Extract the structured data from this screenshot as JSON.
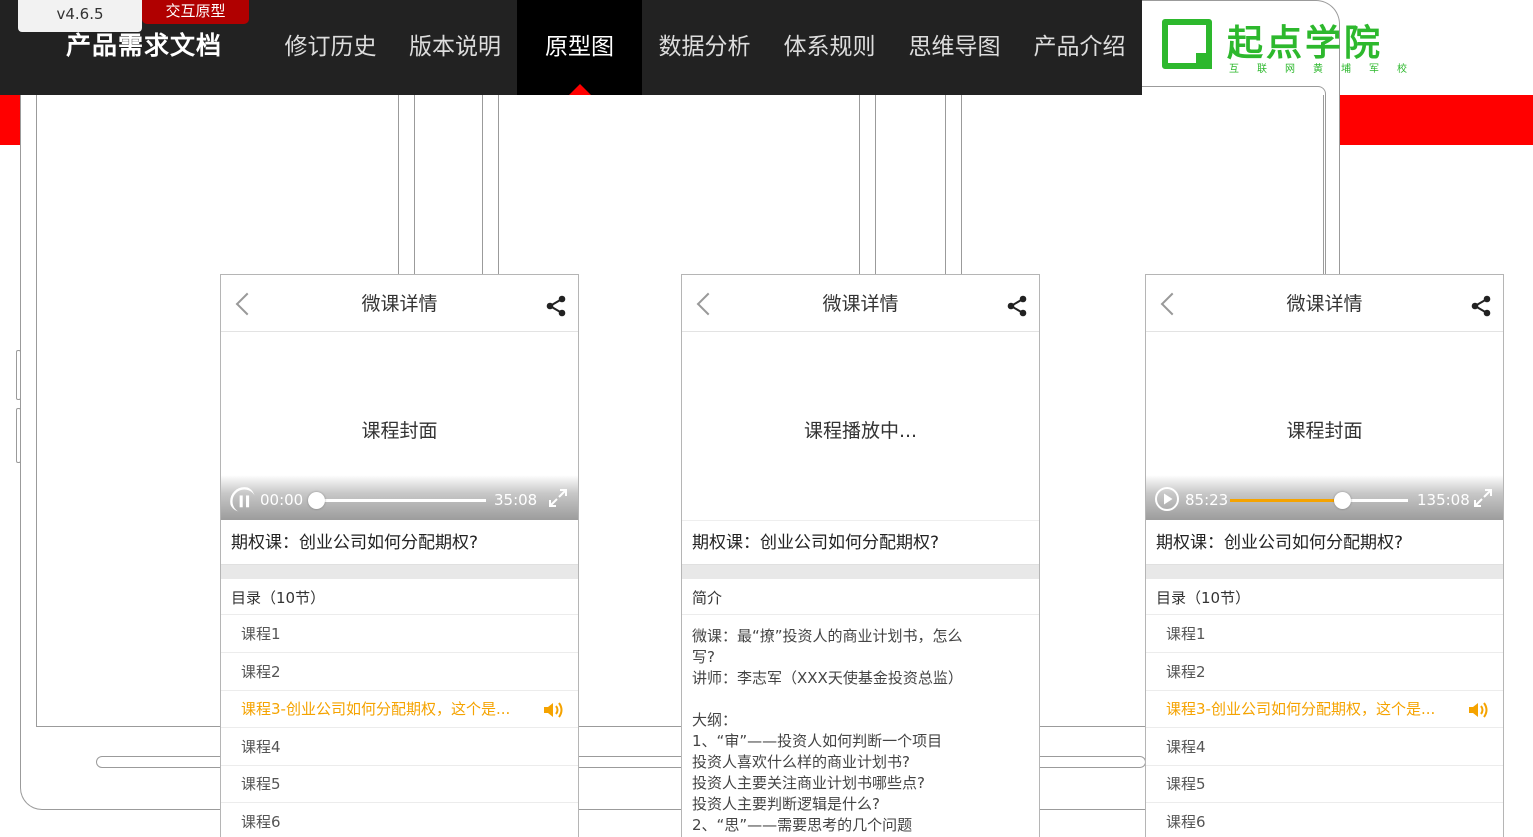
{
  "header": {
    "version": "v4.6.5",
    "tag": "交互原型",
    "doc_title": "产品需求文档",
    "nav": [
      {
        "label": "修订历史",
        "active": false
      },
      {
        "label": "版本说明",
        "active": false
      },
      {
        "label": "原型图",
        "active": true
      },
      {
        "label": "数据分析",
        "active": false
      },
      {
        "label": "体系规则",
        "active": false
      },
      {
        "label": "思维导图",
        "active": false
      },
      {
        "label": "产品介绍",
        "active": false
      }
    ]
  },
  "logo": {
    "name": "起点学院",
    "subtitle": "互联网黄埔军校"
  },
  "colors": {
    "topbar": "#222222",
    "accent_red": "#ff0000",
    "brand_green": "#2db82d",
    "highlight_orange": "#f5a300"
  },
  "panels": [
    {
      "title": "微课详情",
      "cover_label": "课程封面",
      "player": {
        "current": "00:00",
        "total": "35:08",
        "progress": 0.0,
        "state": "paused-icon"
      },
      "course_title": "期权课：创业公司如何分配期权?",
      "section_title": "目录（10节）",
      "lessons": [
        "课程1",
        "课程2",
        "课程3-创业公司如何分配期权，这个是...",
        "课程4",
        "课程5",
        "课程6"
      ],
      "active_lesson": 2
    },
    {
      "title": "微课详情",
      "cover_label": "课程播放中...",
      "course_title": "期权课：创业公司如何分配期权?",
      "section_title": "简介",
      "intro_lines": [
        "微课：最“撩”投资人的商业计划书，怎么",
        "写?",
        "讲师：李志军（XXX天使基金投资总监）",
        "",
        "大纲：",
        "1、“审”——投资人如何判断一个项目",
        "投资人喜欢什么样的商业计划书?",
        "投资人主要关注商业计划书哪些点?",
        "投资人主要判断逻辑是什么?",
        "2、“思”——需要思考的几个问题"
      ]
    },
    {
      "title": "微课详情",
      "cover_label": "课程封面",
      "player": {
        "current": "85:23",
        "total": "135:08",
        "progress": 0.63,
        "state": "play-icon"
      },
      "course_title": "期权课：创业公司如何分配期权?",
      "section_title": "目录（10节）",
      "lessons": [
        "课程1",
        "课程2",
        "课程3-创业公司如何分配期权，这个是...",
        "课程4",
        "课程5",
        "课程6"
      ],
      "active_lesson": 2
    }
  ]
}
